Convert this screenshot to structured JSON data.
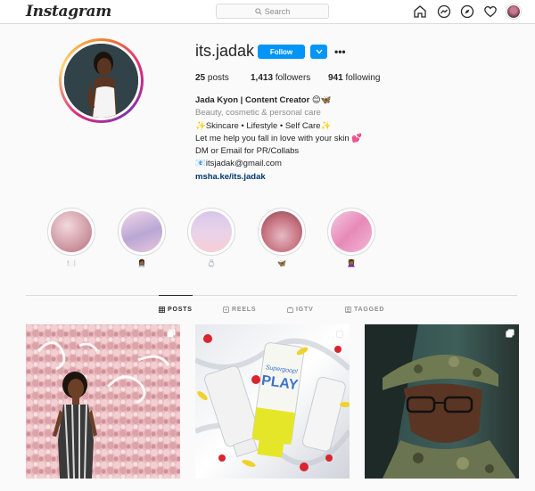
{
  "brand": {
    "logo_text": "Instagram"
  },
  "search": {
    "placeholder": "Search"
  },
  "nav": {
    "icons": [
      "home-icon",
      "messenger-icon",
      "explore-icon",
      "activity-heart-icon",
      "profile-avatar-icon"
    ]
  },
  "profile": {
    "username": "its.jadak",
    "follow_label": "Follow",
    "more_label": "•••",
    "stats": {
      "posts_count": "25",
      "posts_label": "posts",
      "followers_count": "1,413",
      "followers_label": "followers",
      "following_count": "941",
      "following_label": "following"
    },
    "bio": {
      "name": "Jada Kyon | Content Creator 😊🦋",
      "category": "Beauty, cosmetic & personal care",
      "line1": "✨Skincare • Lifestyle • Self Care✨",
      "line2": "Let me help you fall in love with your skin 💕",
      "line3": "DM or Email for PR/Collabs",
      "email": "📧itsjadak@gmail.com",
      "link": "msha.ke/its.jadak"
    }
  },
  "highlights": [
    {
      "label": "🍽️",
      "color_a": "#c98f9b",
      "color_b": "#f0d2d6"
    },
    {
      "label": "👩🏾‍⚕️",
      "color_a": "#b9a7d4",
      "color_b": "#f2d7ea"
    },
    {
      "label": "💍",
      "color_a": "#d6c6e8",
      "color_b": "#f7cdd5"
    },
    {
      "label": "🦋",
      "color_a": "#c7727f",
      "color_b": "#e6b9c3"
    },
    {
      "label": "💆🏾‍♀️",
      "color_a": "#e68ab8",
      "color_b": "#f6c9e0"
    }
  ],
  "tabs": [
    {
      "label": "POSTS",
      "icon": "grid-icon",
      "active": true
    },
    {
      "label": "REELS",
      "icon": "reels-icon",
      "active": false
    },
    {
      "label": "IGTV",
      "icon": "igtv-icon",
      "active": false
    },
    {
      "label": "TAGGED",
      "icon": "tagged-icon",
      "active": false
    }
  ],
  "colors": {
    "accent": "#0095f6",
    "link": "#00376b",
    "text": "#262626",
    "muted": "#8e8e8e",
    "border": "#dbdbdb"
  },
  "posts": [
    {
      "type": "carousel",
      "subject": "woman in striped jumpsuit before pink flower wall"
    },
    {
      "type": "carousel",
      "subject": "Supergoop PLAY sunscreen tubes on white satin"
    },
    {
      "type": "carousel",
      "subject": "woman in military uniform and glasses in car"
    }
  ],
  "post3": {
    "tube_brand": "Supergoop!",
    "tube_name": "PLAY"
  }
}
